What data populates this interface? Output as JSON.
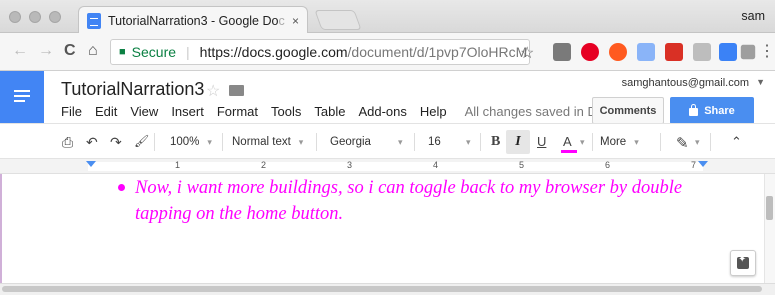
{
  "browser": {
    "tab": {
      "title": "TutorialNarration3 - Google Do",
      "title_fade": "c",
      "close": "×"
    },
    "profile_name": "sam",
    "nav": {
      "back": "←",
      "forward": "→",
      "reload": "C",
      "home": "⌂"
    },
    "address": {
      "secure_label": "Secure",
      "url_host": "https://docs.google.com",
      "url_path": "/document/d/1pvp7OloHRcM..."
    },
    "star": "☆",
    "menu": "⋮"
  },
  "docs": {
    "title": "TutorialNarration3",
    "title_star": "☆",
    "menu_items": [
      "File",
      "Edit",
      "View",
      "Insert",
      "Format",
      "Tools",
      "Table",
      "Add-ons",
      "Help"
    ],
    "save_status": "All changes saved in Dr...",
    "account_email": "samghantous@gmail.com",
    "account_caret": "▼",
    "comments_label": "Comments",
    "share_label": "Share"
  },
  "toolbar": {
    "print": "⎙",
    "undo": "↶",
    "redo": "↷",
    "paint_format": "🖌",
    "zoom": "100%",
    "style": "Normal text",
    "font": "Georgia",
    "font_size": "16",
    "bold": "B",
    "italic": "I",
    "underline": "U",
    "text_color": "A",
    "more": "More",
    "pen": "✎",
    "collapse": "⌃",
    "caret": "▾",
    "text_color_hex": "#ff00ff"
  },
  "ruler": {
    "numbers": [
      "1",
      "2",
      "3",
      "4",
      "5",
      "6",
      "7"
    ]
  },
  "document": {
    "bullet_text": "Now, i want more buildings, so i can toggle back to my browser by double tapping on the home button.",
    "text_color": "#ff00ff"
  }
}
